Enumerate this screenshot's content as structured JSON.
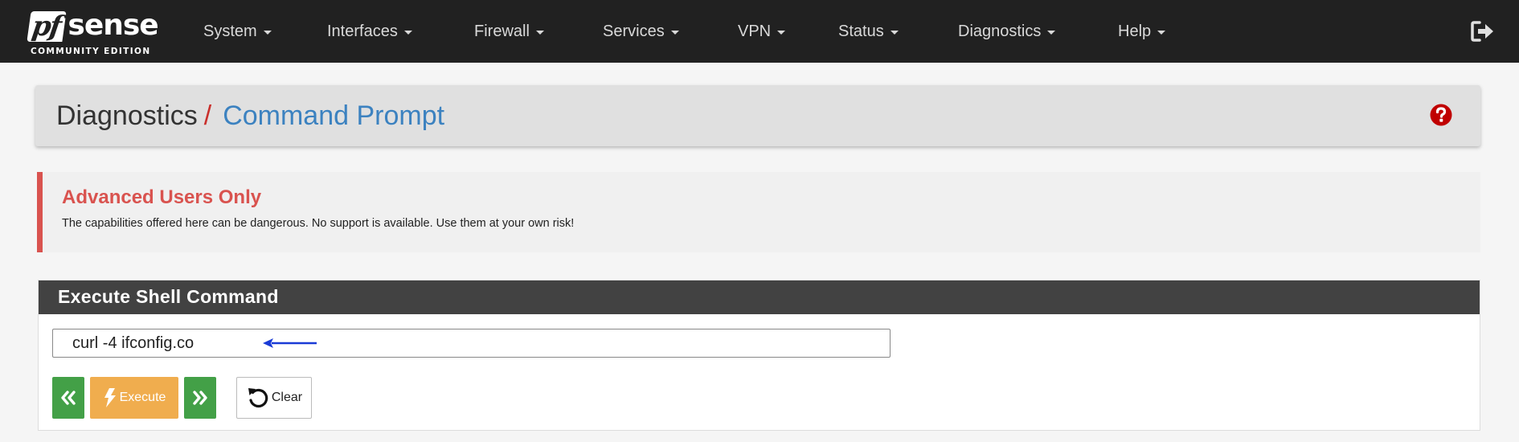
{
  "brand": {
    "pf": "pf",
    "sense": "sense",
    "edition": "COMMUNITY EDITION"
  },
  "nav": {
    "items": [
      {
        "label": "System"
      },
      {
        "label": "Interfaces"
      },
      {
        "label": "Firewall"
      },
      {
        "label": "Services"
      },
      {
        "label": "VPN"
      },
      {
        "label": "Status"
      },
      {
        "label": "Diagnostics"
      },
      {
        "label": "Help"
      }
    ],
    "logout_icon": "sign-out-icon"
  },
  "breadcrumb": {
    "parent": "Diagnostics",
    "separator": "/",
    "current": "Command Prompt",
    "help_icon": "question-circle-icon"
  },
  "alert": {
    "title": "Advanced Users Only",
    "text": "The capabilities offered here can be dangerous. No support is available. Use them at your own risk!"
  },
  "shell_panel": {
    "heading": "Execute Shell Command",
    "command_value": "curl -4 ifconfig.co",
    "buttons": {
      "prev_icon": "double-chevron-left-icon",
      "execute_label": "Execute",
      "execute_icon": "bolt-icon",
      "next_icon": "double-chevron-right-icon",
      "clear_label": "Clear",
      "clear_icon": "undo-icon"
    }
  },
  "colors": {
    "navbar": "#212121",
    "accent_blue": "#3c82c0",
    "alert_red": "#d9534f",
    "btn_green": "#43a047",
    "btn_orange": "#f0ad4e",
    "annotation_arrow": "#1a3bd6"
  }
}
